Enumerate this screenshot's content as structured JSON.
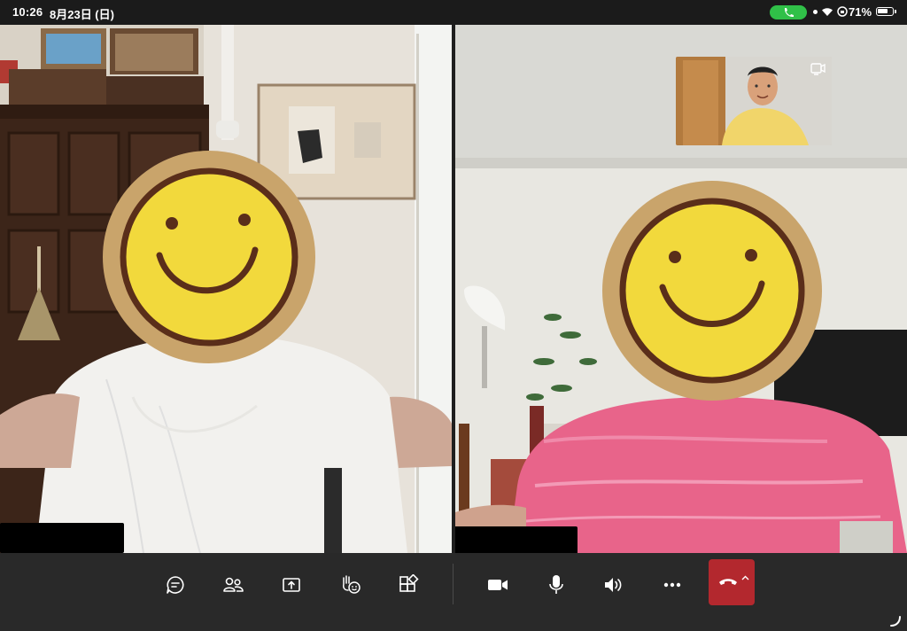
{
  "status_bar": {
    "time": "10:26",
    "date": "8月23日 (日)",
    "battery_percent": "71%",
    "battery_level": 0.71
  },
  "tiles": {
    "left": {
      "participant_name": ""
    },
    "right": {
      "participant_name": ""
    }
  },
  "toolbar": {
    "left_group": [
      "chat-icon",
      "people-icon",
      "share-screen-icon",
      "reactions-icon",
      "apps-icon"
    ],
    "right_group": [
      "camera-icon",
      "microphone-icon",
      "speaker-icon",
      "more-icon",
      "hang-up-icon"
    ],
    "hangup_color": "#b3282e"
  },
  "colors": {
    "accent_call": "#30c048",
    "background": "#1f1f1f",
    "toolbar": "#292929"
  }
}
